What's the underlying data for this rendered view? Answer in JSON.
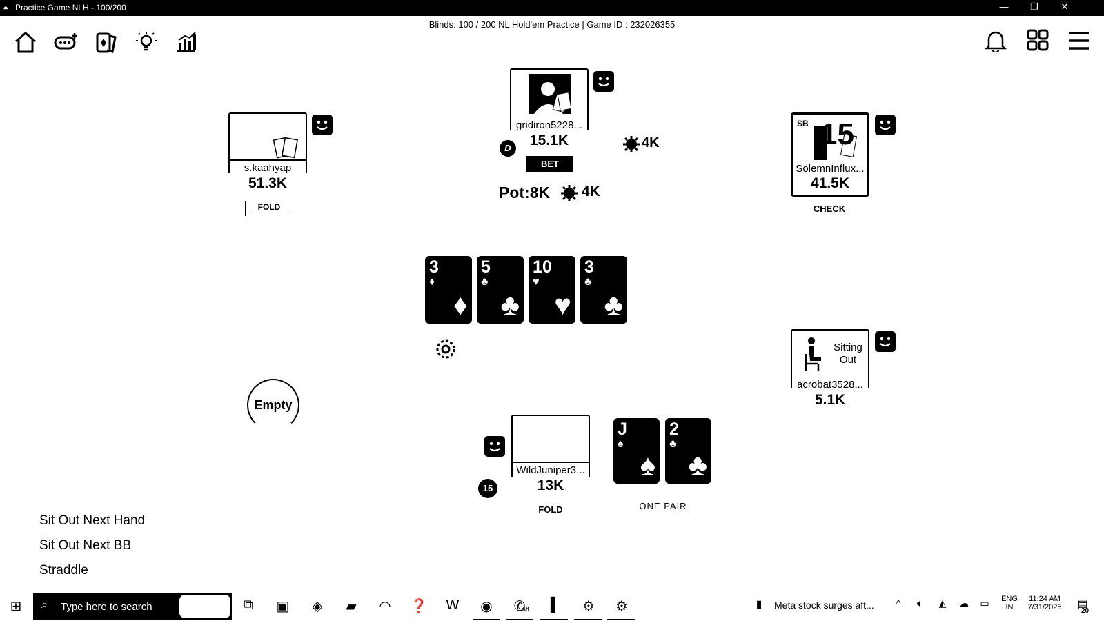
{
  "window": {
    "title": "Practice Game NLH - 100/200",
    "controls": [
      "minimize-icon",
      "restore-icon",
      "close-icon"
    ]
  },
  "header": {
    "game_info": "Blinds: 100 / 200  NL Hold'em Practice | Game ID : 232026355"
  },
  "toolbar_left": [
    "home-icon",
    "add-table-icon",
    "cards-icon",
    "hint-bulb-icon",
    "stats-chart-icon"
  ],
  "toolbar_right": [
    "bell-icon",
    "grid-icon",
    "hamburger-menu-icon"
  ],
  "players": {
    "top": {
      "name": "gridiron5228...",
      "stack": "15.1K",
      "action": "BET",
      "dealer": "D",
      "bet": "4K"
    },
    "left": {
      "name": "s.kaahyap",
      "stack": "51.3K",
      "action": "FOLD"
    },
    "right_top": {
      "name": "SolemnInflux...",
      "stack": "41.5K",
      "action": "CHECK",
      "badge": "SB",
      "timer": "15"
    },
    "right_bottom": {
      "name": "acrobat3528...",
      "stack": "5.1K",
      "status": "Sitting Out"
    },
    "hero": {
      "name": "WildJuniper3...",
      "stack": "13K",
      "action": "FOLD",
      "timer": "15",
      "hand_rank": "ONE PAIR"
    }
  },
  "empty_seat": "Empty",
  "pot": {
    "label": "Pot:8K",
    "bets": "4K"
  },
  "board": [
    {
      "rank": "3",
      "suit": "♦"
    },
    {
      "rank": "5",
      "suit": "♣"
    },
    {
      "rank": "10",
      "suit": "♥"
    },
    {
      "rank": "3",
      "suit": "♣"
    }
  ],
  "hero_cards": [
    {
      "rank": "J",
      "suit": "♠"
    },
    {
      "rank": "2",
      "suit": "♣"
    }
  ],
  "options": [
    "Sit Out Next Hand",
    "Sit Out Next BB",
    "Straddle"
  ],
  "taskbar": {
    "search_placeholder": "Type here to search",
    "news": "Meta stock surges aft...",
    "lang": "ENG",
    "region": "IN",
    "time": "11:24 AM",
    "date": "7/31/2025",
    "whatsapp_badge": "48",
    "notif_count": "20"
  }
}
